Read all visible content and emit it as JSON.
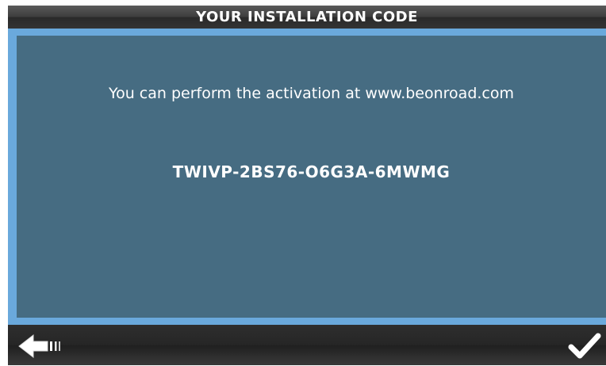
{
  "header": {
    "title": "YOUR INSTALLATION CODE"
  },
  "main": {
    "activation_message": "You can perform the activation at www.beonroad.com",
    "installation_code": "TWIVP-2BS76-O6G3A-6MWMG"
  },
  "footer": {
    "back_icon": "back-arrow-icon",
    "confirm_icon": "checkmark-icon"
  },
  "colors": {
    "title_bar": "#3e3e3e",
    "frame_border": "#6aa9dc",
    "panel_background": "#466c82",
    "text": "#ffffff"
  }
}
